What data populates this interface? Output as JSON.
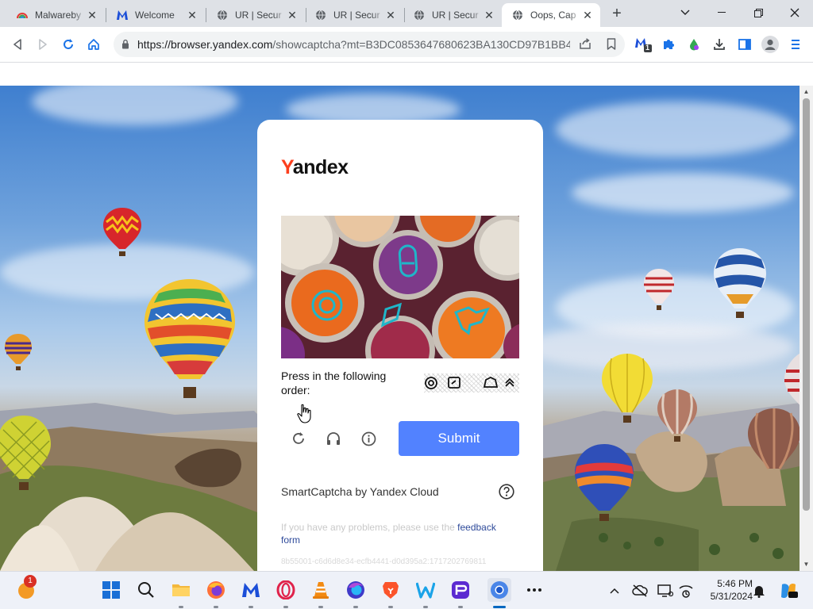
{
  "browser": {
    "tabs": [
      {
        "title": "Malwareby",
        "icon": "rainbow-icon"
      },
      {
        "title": "Welcome",
        "icon": "malwarebytes-icon"
      },
      {
        "title": "UR | Secur",
        "icon": "globe-icon"
      },
      {
        "title": "UR | Secur",
        "icon": "globe-icon"
      },
      {
        "title": "UR | Secur",
        "icon": "globe-icon"
      },
      {
        "title": "Oops, Cap",
        "icon": "globe-icon"
      }
    ],
    "url_host": "https://browser.yandex.com",
    "url_path": "/showcaptcha?mt=B3DC0853647680623BA130CD97B1BB4...",
    "extension_badge": "1"
  },
  "captcha": {
    "logo_first": "Y",
    "logo_rest": "andex",
    "task_text": "Press in the following order:",
    "submit_label": "Submit",
    "brand_text": "SmartCaptcha by Yandex Cloud",
    "problems_text": "If you have any problems, please use the ",
    "feedback_link": "feedback form",
    "token": "8b55001-c6d6d8e34-ecfb4441-d0d395a2:1717202769811",
    "accent_color": "#5282ff",
    "logo_color": "#fc3f1d"
  },
  "taskbar": {
    "notification_badge": "1",
    "time": "5:46 PM",
    "date": "5/31/2024"
  }
}
